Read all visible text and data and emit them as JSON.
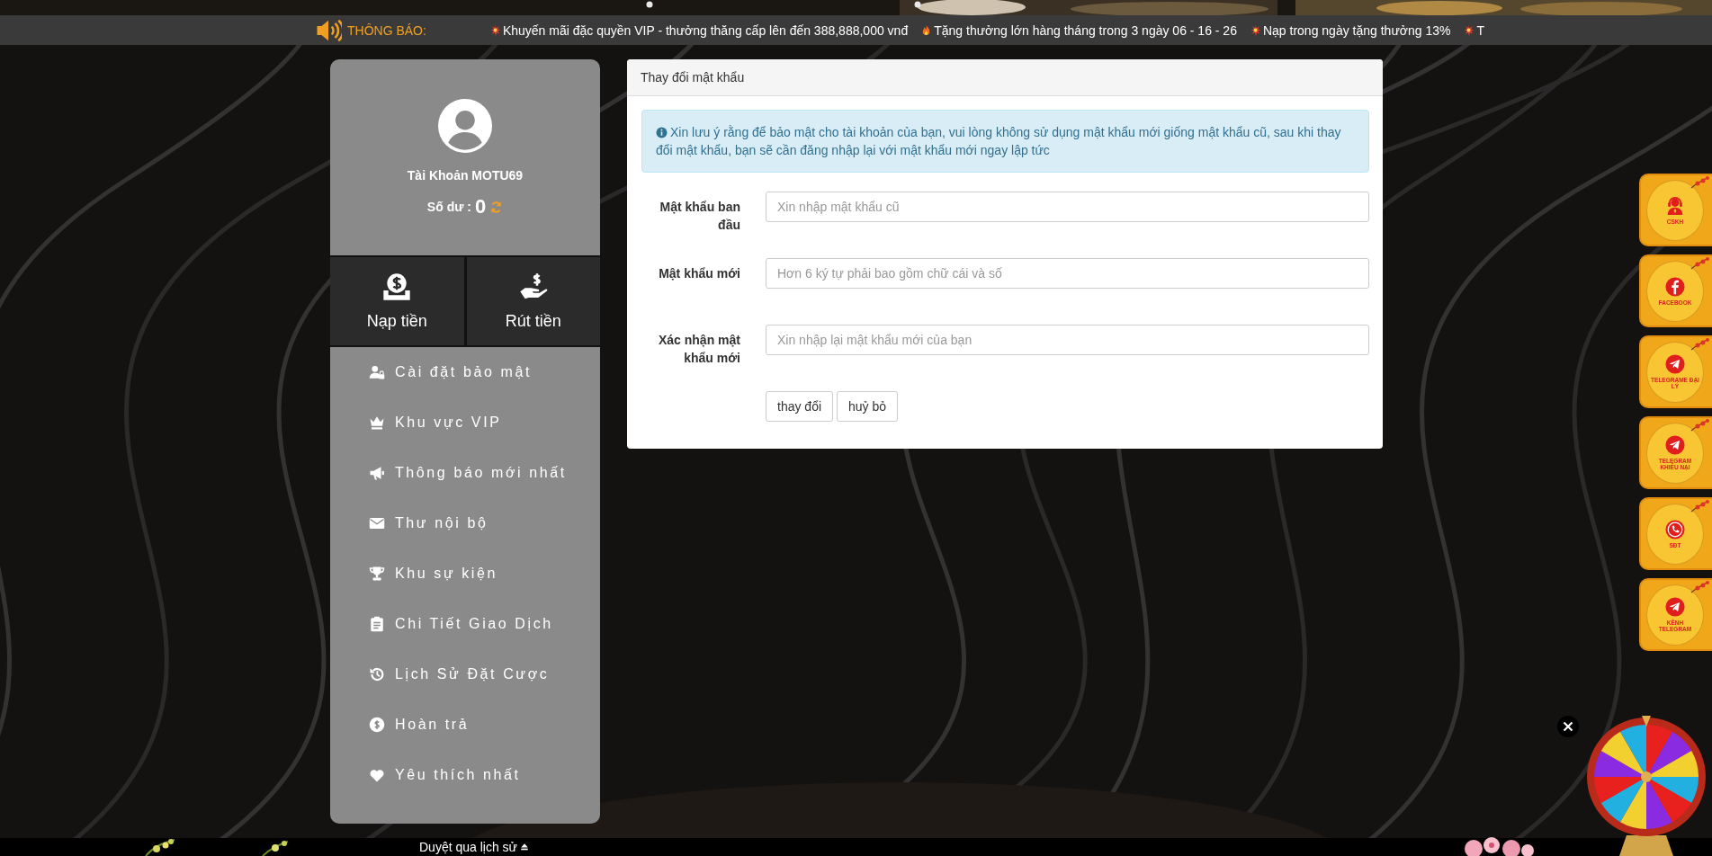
{
  "notice_bar": {
    "label": "THÔNG BÁO:",
    "items": [
      {
        "kind": "burst",
        "text": "Khuyến mãi đặc quyền VIP - thưởng thăng cấp lên đến 388,888,000 vnđ"
      },
      {
        "kind": "flame",
        "text": "Tặng thưởng lớn hàng tháng trong 3 ngày 06 - 16 - 26"
      },
      {
        "kind": "burst",
        "text": "Nạp trong ngày tặng thưởng 13%"
      },
      {
        "kind": "burst",
        "text": "T"
      }
    ]
  },
  "account": {
    "name": "Tài Khoản MOTU69",
    "balance_label": "Số dư :",
    "balance": "0"
  },
  "wallet_actions": [
    {
      "kind": "deposit",
      "label": "Nạp tiền"
    },
    {
      "kind": "withdraw",
      "label": "Rút tiền"
    }
  ],
  "menu": [
    {
      "kind": "user-lock",
      "label": "Cài đặt bảo mật"
    },
    {
      "kind": "crown",
      "label": "Khu vực VIP"
    },
    {
      "kind": "bullhorn",
      "label": "Thông báo mới nhất"
    },
    {
      "kind": "envelope",
      "label": "Thư nội bộ"
    },
    {
      "kind": "trophy",
      "label": "Khu sự kiện"
    },
    {
      "kind": "clipboard",
      "label": "Chi Tiết Giao Dịch"
    },
    {
      "kind": "history",
      "label": "Lịch Sử Đặt Cược"
    },
    {
      "kind": "coin",
      "label": "Hoàn trả"
    },
    {
      "kind": "heart",
      "label": "Yêu thích nhất"
    }
  ],
  "form": {
    "title": "Thay đổi mật khẩu",
    "notice": "Xin lưu ý rằng để bảo mật cho tài khoản của bạn, vui lòng không sử dụng mật khẩu mới giống mật khẩu cũ, sau khi thay đổi mật khẩu, bạn sẽ cần đăng nhập lại với mật khẩu mới ngay lập tức",
    "fields": [
      {
        "label": "Mật khẩu ban đầu",
        "placeholder": "Xin nhập mật khẩu cũ"
      },
      {
        "label": "Mật khẩu mới",
        "placeholder": "Hơn 6 ký tự phải bao gồm chữ cái và số"
      },
      {
        "label": "Xác nhận mật khẩu mới",
        "placeholder": "Xin nhập lại mật khẩu mới của bạn"
      }
    ],
    "buttons": [
      "thay đổi",
      "huỷ bỏ"
    ]
  },
  "side_contacts": [
    {
      "kind": "agent",
      "label": "CSKH"
    },
    {
      "kind": "facebook",
      "label": "FACEBOOK"
    },
    {
      "kind": "telegram",
      "label": "TELEGRAME ĐẠI LÝ"
    },
    {
      "kind": "telegram",
      "label": "TELEGRAM KHIẾU NẠI"
    },
    {
      "kind": "phone",
      "label": "SĐT"
    },
    {
      "kind": "telegram",
      "label": "KÊNH TELEGRAM"
    }
  ],
  "footer": {
    "history_link": "Duyệt qua lịch sử"
  }
}
